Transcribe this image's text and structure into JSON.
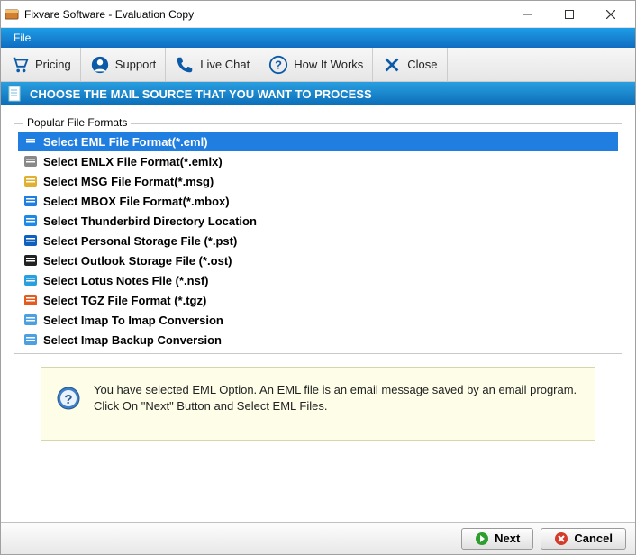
{
  "window": {
    "title": "Fixvare Software - Evaluation Copy"
  },
  "menubar": {
    "file": "File"
  },
  "toolbar": {
    "pricing": "Pricing",
    "support": "Support",
    "livechat": "Live Chat",
    "howitworks": "How It Works",
    "close": "Close"
  },
  "instruction": "CHOOSE THE MAIL SOURCE THAT YOU WANT TO PROCESS",
  "group_title": "Popular File Formats",
  "formats": [
    {
      "label": "Select EML File Format(*.eml)",
      "selected": true
    },
    {
      "label": "Select EMLX File Format(*.emlx)",
      "selected": false
    },
    {
      "label": "Select MSG File Format(*.msg)",
      "selected": false
    },
    {
      "label": "Select MBOX File Format(*.mbox)",
      "selected": false
    },
    {
      "label": "Select Thunderbird Directory Location",
      "selected": false
    },
    {
      "label": "Select Personal Storage File (*.pst)",
      "selected": false
    },
    {
      "label": "Select Outlook Storage File (*.ost)",
      "selected": false
    },
    {
      "label": "Select Lotus Notes File (*.nsf)",
      "selected": false
    },
    {
      "label": "Select TGZ File Format (*.tgz)",
      "selected": false
    },
    {
      "label": "Select Imap To Imap Conversion",
      "selected": false
    },
    {
      "label": "Select Imap Backup Conversion",
      "selected": false
    }
  ],
  "info_text": "You have selected EML Option. An EML file is an email message saved by an email program. Click On \"Next\" Button and Select EML Files.",
  "buttons": {
    "next": "Next",
    "cancel": "Cancel"
  },
  "icon_colors": {
    "eml": "#1f7ee0",
    "emlx": "#888",
    "msg": "#e0b030",
    "mbox": "#1f7ee0",
    "thunderbird": "#1e88e5",
    "pst": "#0f5fbf",
    "ost": "#222",
    "nsf": "#2a9fe0",
    "tgz": "#e55a1f",
    "imap1": "#4aa0e0",
    "imap2": "#4aa0e0"
  }
}
